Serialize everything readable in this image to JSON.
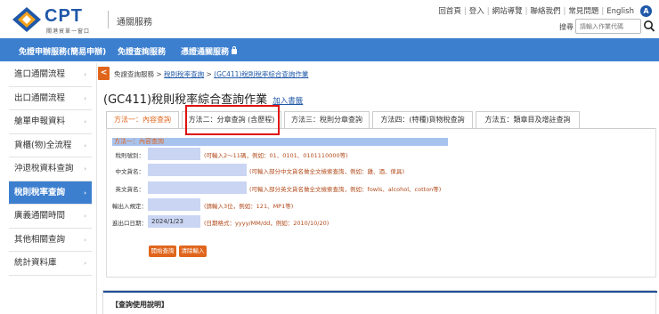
{
  "header": {
    "logo_text": "CPT",
    "logo_sub": "關港貿單一窗口",
    "site_name": "通關服務",
    "top_links": [
      "回首頁",
      "登入",
      "網站導覽",
      "聯絡我們",
      "常見問題",
      "English"
    ],
    "a11y_label": "A",
    "search_label": "搜尋",
    "search_placeholder": "請輸入作業代碼"
  },
  "navbar": {
    "items": [
      "免證申辦服務(簡易申辦)",
      "免證查詢服務",
      "憑證通關服務"
    ]
  },
  "sidebar": {
    "items": [
      {
        "label": "進口通關流程",
        "active": false
      },
      {
        "label": "出口通關流程",
        "active": false
      },
      {
        "label": "艙單申報資料",
        "active": false
      },
      {
        "label": "貨櫃(物)全流程",
        "active": false
      },
      {
        "label": "沖退稅資料查詢",
        "active": false
      },
      {
        "label": "稅則稅率查詢",
        "active": true
      },
      {
        "label": "廣義通關時間",
        "active": false
      },
      {
        "label": "其他相關查詢",
        "active": false
      },
      {
        "label": "統計資料庫",
        "active": false
      }
    ]
  },
  "main": {
    "collapse_glyph": "<",
    "breadcrumb": [
      "免證查詢服務",
      "稅則稅率查詢",
      "(GC411)稅則稅率綜合查詢作業"
    ],
    "breadcrumb_sep": ">",
    "title": "(GC411)稅則稅率綜合查詢作業",
    "bookmark": "加入書籤",
    "tabs": [
      {
        "label": "方法一：內容查詢",
        "active": true
      },
      {
        "label": "方法二：分章查詢 (含歷程)",
        "active": false
      },
      {
        "label": "方法三：稅則分章查詢",
        "active": false
      },
      {
        "label": "方法四：(特種)貨物稅查詢",
        "active": false
      },
      {
        "label": "方法五：類章目及增註查詢",
        "active": false
      }
    ],
    "section_title": "方法一：內容查詢",
    "form": {
      "tariff_label": "稅則號別：",
      "tariff_value": "",
      "tariff_hint": "(可輸入2～11碼，例如：01、0101、0101110000等)",
      "cn_name_label": "中文貨名：",
      "cn_name_value": "",
      "cn_name_hint": "(可輸入部分中文貨名做全文檢索查詢，例如：雞、酒、傢具)",
      "en_name_label": "英文貨名：",
      "en_name_value": "",
      "en_name_hint": "(可輸入部分英文貨名做全文檢索查詢，例如：fowls、alcohol、cotton等)",
      "rule_label": "輸出入規定：",
      "rule_value": "",
      "rule_hint": "(請輸入3位，例如：121、MP1等)",
      "date_label": "進出口日期：",
      "date_value": "2024/1/23",
      "date_hint": "(日期格式：yyyy/MM/dd，例如：2010/10/20)"
    },
    "buttons": {
      "query": "開始查詢",
      "clear": "清除輸入"
    },
    "usage_title": "【查詢使用說明】"
  },
  "colors": {
    "brand_blue": "#1f58a8",
    "nav_blue": "#3d7fcf",
    "accent_orange": "#e0651c",
    "highlight_red": "#e01010",
    "input_fill": "#c9d5f3"
  }
}
